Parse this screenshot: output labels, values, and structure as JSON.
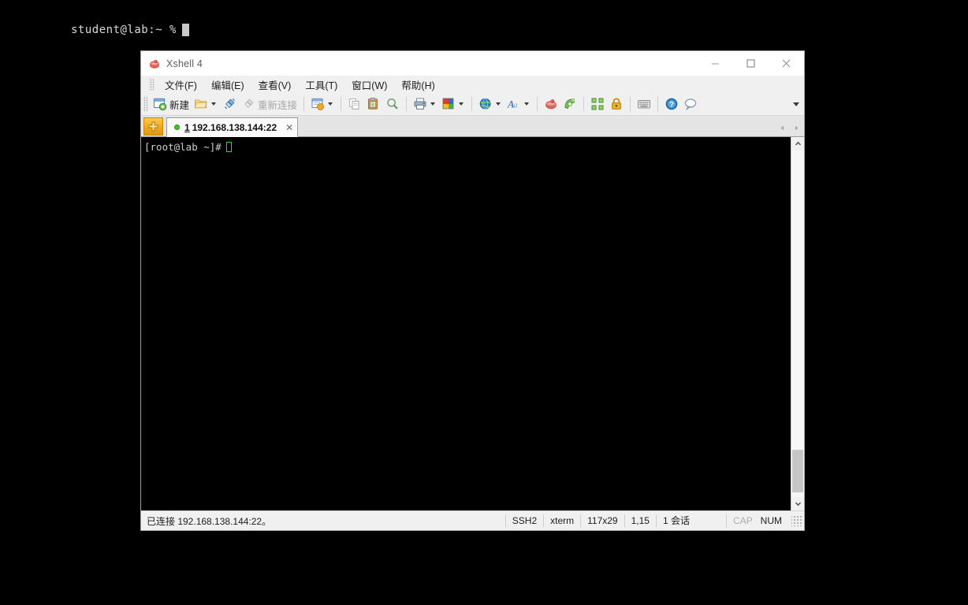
{
  "desktop": {
    "prompt": "student@lab:~ %",
    "cursor_icon": "block-cursor"
  },
  "window": {
    "title": "Xshell 4",
    "app_icon": "xshell-logo-icon",
    "controls": {
      "minimize": "minimize-icon",
      "maximize": "maximize-icon",
      "close": "close-icon"
    }
  },
  "menubar": {
    "items": [
      {
        "label": "文件(F)",
        "name": "menu-file"
      },
      {
        "label": "编辑(E)",
        "name": "menu-edit"
      },
      {
        "label": "查看(V)",
        "name": "menu-view"
      },
      {
        "label": "工具(T)",
        "name": "menu-tools"
      },
      {
        "label": "窗口(W)",
        "name": "menu-window"
      },
      {
        "label": "帮助(H)",
        "name": "menu-help"
      }
    ]
  },
  "toolbar": {
    "new_label": "新建",
    "reconnect_label": "重新连接",
    "overflow_icon": "chevron-down-icon",
    "icons": {
      "new": "new-session-icon",
      "open": "open-folder-icon",
      "connect": "connect-plug-icon",
      "reconnect": "reconnect-plug-icon",
      "session_manager": "session-manager-icon",
      "copy": "copy-icon",
      "paste": "paste-icon",
      "find": "search-icon",
      "print": "printer-icon",
      "color_scheme": "color-palette-icon",
      "globe": "globe-icon",
      "font": "font-icon",
      "xshell": "xshell-icon",
      "xftp": "xftp-icon",
      "fullscreen": "fullscreen-icon",
      "lock": "lock-icon",
      "keyboard": "keyboard-icon",
      "help": "help-icon",
      "chat": "chat-bubble-icon"
    }
  },
  "tabbar": {
    "newtab_icon": "new-tab-icon",
    "tabs": [
      {
        "number": "1",
        "title": "192.168.138.144:22",
        "status_icon": "connected-dot-icon",
        "close_icon": "close-tab-icon",
        "active": true
      }
    ],
    "nav": {
      "prev_icon": "arrow-left-icon",
      "next_icon": "arrow-right-icon"
    }
  },
  "terminal": {
    "lines": [
      "[root@lab ~]#"
    ],
    "cursor_icon": "terminal-cursor",
    "background_color": "#000000",
    "foreground_color": "#cfcfcf",
    "cursor_color": "#33d633"
  },
  "scrollbar": {
    "up_icon": "scroll-up-icon",
    "down_icon": "scroll-down-icon"
  },
  "statusbar": {
    "connection": "已连接 192.168.138.144:22。",
    "protocol": "SSH2",
    "terminal_type": "xterm",
    "size": "117x29",
    "cursor_position": "1,15",
    "sessions": "1 会话",
    "caps": "CAP",
    "num": "NUM",
    "grip_icon": "resize-grip-icon"
  }
}
